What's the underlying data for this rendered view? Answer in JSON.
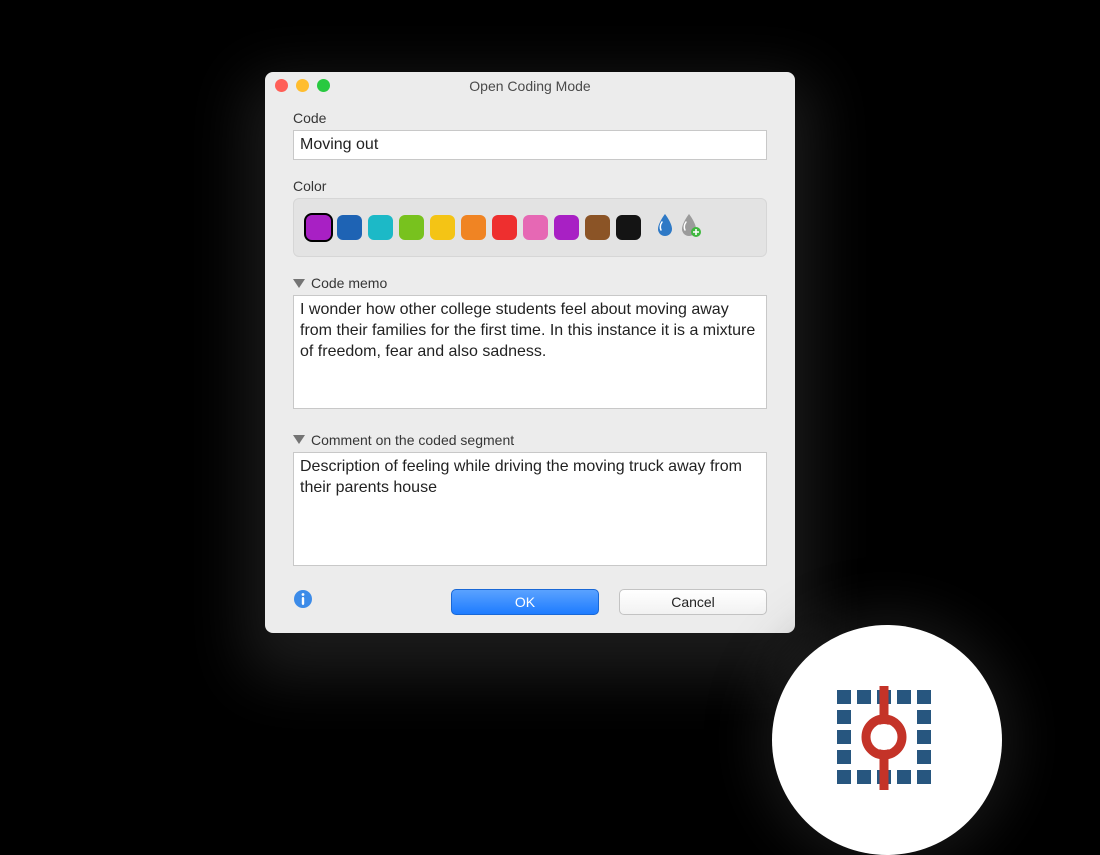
{
  "window": {
    "title": "Open Coding Mode"
  },
  "codeField": {
    "label": "Code",
    "value": "Moving out"
  },
  "colorSection": {
    "label": "Color",
    "selectedIndex": 0,
    "swatches": [
      "#a820c4",
      "#1e63b4",
      "#1cb9c7",
      "#78c21e",
      "#f4c415",
      "#f08423",
      "#ee2f2f",
      "#e668b4",
      "#a820c4",
      "#8b5426",
      "#141414"
    ],
    "eyedropper": "color-picker-icon",
    "addEyedropper": "add-color-picker-icon"
  },
  "memoSection": {
    "label": "Code memo",
    "value": "I wonder how other college students feel about moving away from their families for the first time. In this instance it is a mixture of freedom, fear and also sadness."
  },
  "commentSection": {
    "label": "Comment on the coded segment",
    "value": "Description of feeling while driving the moving truck away from their parents house"
  },
  "buttons": {
    "ok": "OK",
    "cancel": "Cancel"
  }
}
